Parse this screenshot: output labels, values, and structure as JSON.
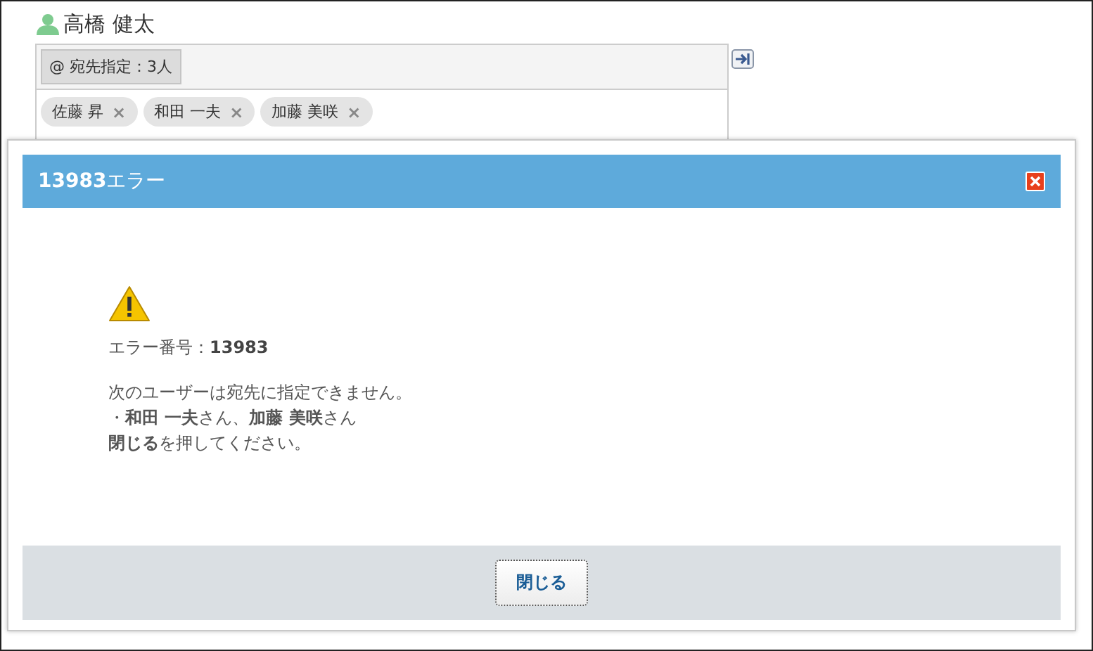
{
  "user": {
    "name": "高橋 健太"
  },
  "recipients": {
    "label": "@ 宛先指定：3人",
    "chips": [
      {
        "name": "佐藤 昇",
        "remove": "×"
      },
      {
        "name": "和田 一夫",
        "remove": "×"
      },
      {
        "name": "加藤 美咲",
        "remove": "×"
      }
    ]
  },
  "dialog": {
    "title": "**13983**エラー",
    "error_number": "エラー番号：**13983**",
    "message": [
      "次のユーザーは宛先に指定できません。",
      "・**和田 一夫**さん、**加藤 美咲**さん",
      "**閉じる**を押してください。"
    ],
    "button": "閉じる"
  }
}
